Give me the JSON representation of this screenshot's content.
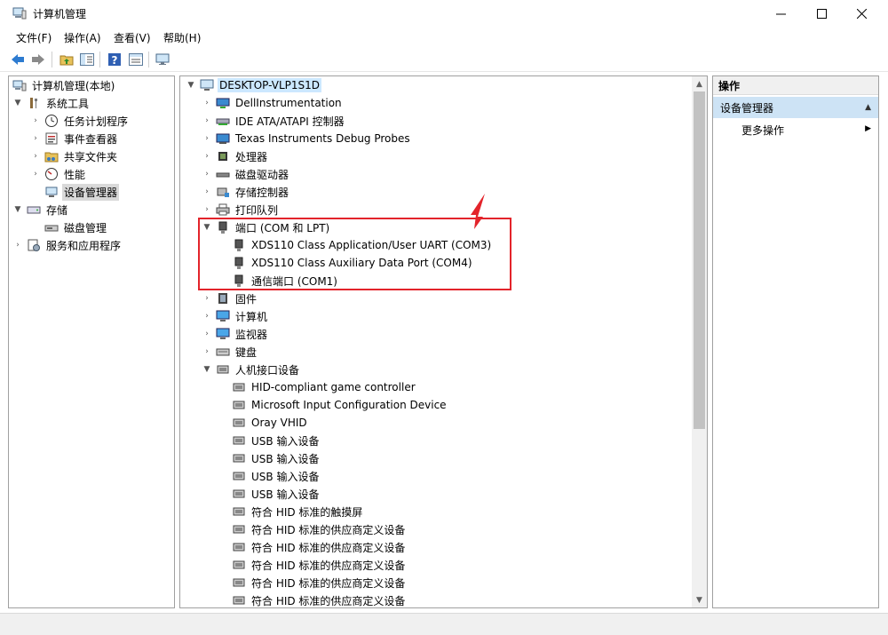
{
  "window": {
    "title": "计算机管理",
    "controls": {
      "minimize": "—",
      "maximize": "☐",
      "close": "✕"
    }
  },
  "menu": [
    "文件(F)",
    "操作(A)",
    "查看(V)",
    "帮助(H)"
  ],
  "toolbar": [
    "back-icon",
    "forward-icon",
    "up-folder-icon",
    "show-hide-tree-icon",
    "help-icon",
    "properties-icon",
    "monitor-icon"
  ],
  "left_tree": {
    "root": "计算机管理(本地)",
    "system_tools": "系统工具",
    "task_scheduler": "任务计划程序",
    "event_viewer": "事件查看器",
    "shared_folders": "共享文件夹",
    "performance": "性能",
    "device_manager": "设备管理器",
    "storage": "存储",
    "disk_management": "磁盘管理",
    "services_apps": "服务和应用程序"
  },
  "device_tree": {
    "root": "DESKTOP-VLP1S1D",
    "categories": [
      "DellInstrumentation",
      "IDE ATA/ATAPI 控制器",
      "Texas Instruments Debug Probes",
      "处理器",
      "磁盘驱动器",
      "存储控制器",
      "打印队列"
    ],
    "ports_category": "端口 (COM 和 LPT)",
    "ports": [
      "XDS110 Class Application/User UART (COM3)",
      "XDS110 Class Auxiliary Data Port (COM4)",
      "通信端口 (COM1)"
    ],
    "after_ports": [
      "固件",
      "计算机",
      "监视器",
      "键盘"
    ],
    "hid_category": "人机接口设备",
    "hid_devices": [
      "HID-compliant game controller",
      "Microsoft Input Configuration Device",
      "Oray VHID",
      "USB 输入设备",
      "USB 输入设备",
      "USB 输入设备",
      "USB 输入设备",
      "符合 HID 标准的触摸屏",
      "符合 HID 标准的供应商定义设备",
      "符合 HID 标准的供应商定义设备",
      "符合 HID 标准的供应商定义设备",
      "符合 HID 标准的供应商定义设备",
      "符合 HID 标准的供应商定义设备"
    ]
  },
  "actions": {
    "header": "操作",
    "group": "设备管理器",
    "more": "更多操作"
  },
  "colors": {
    "highlight_box": "#e3242b",
    "selection": "#cce8ff",
    "action_group": "#cde3f5"
  }
}
